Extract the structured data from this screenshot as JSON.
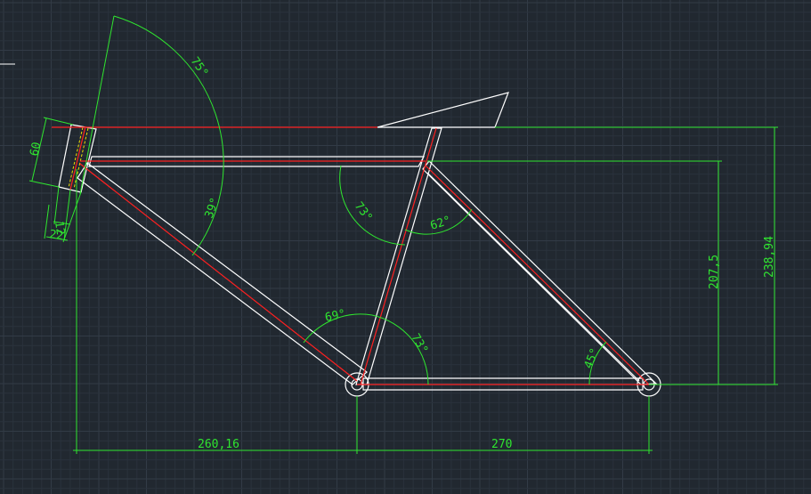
{
  "drawing": {
    "colors": {
      "background": "#212830",
      "grid_minor": "#2a323c",
      "grid_major": "#323b46",
      "frame": "#ffffff",
      "centerline": "#ff2020",
      "dimension": "#2fe62f",
      "hidden_line": "#f0e000"
    },
    "dimensions": {
      "seat_clamp_height": "60",
      "head_tube_offset": "12",
      "head_tube_width": "22",
      "chainstay_length": "270",
      "front_center": "260,16",
      "seat_tube_height": "207,5",
      "saddle_height": "238,94"
    },
    "angles": {
      "head_angle": "75°",
      "top_down_angle": "39°",
      "top_seat_angle": "73°",
      "seat_stay_angle": "62°",
      "down_seat_angle": "69°",
      "seat_chain_angle": "73°",
      "stay_chain_angle": "45°"
    }
  }
}
